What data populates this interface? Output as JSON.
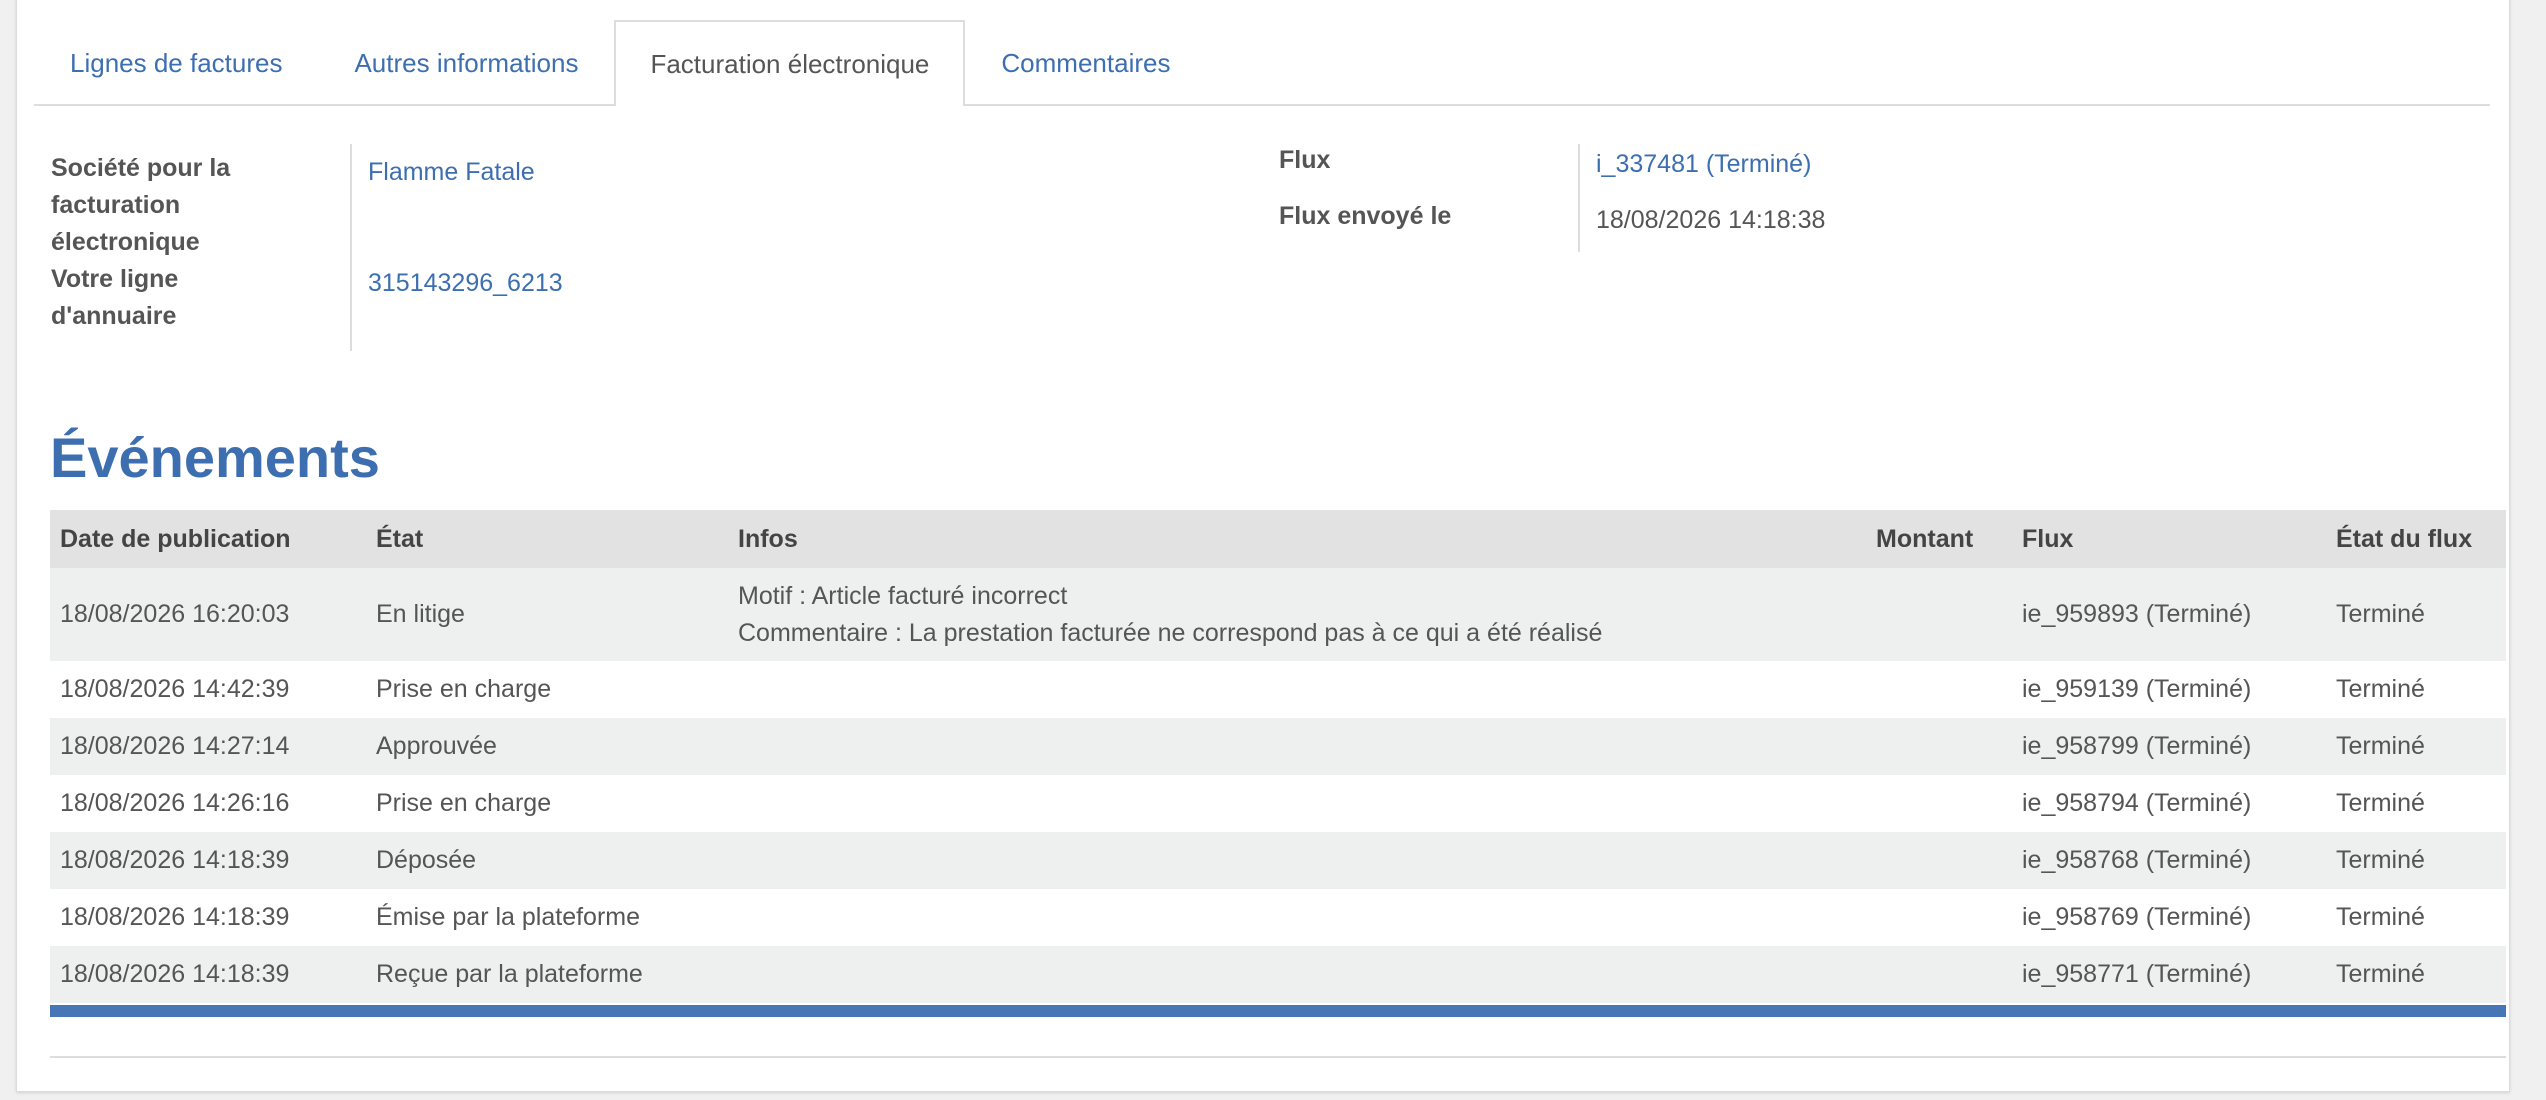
{
  "tabs": [
    {
      "label": "Lignes de factures",
      "active": false
    },
    {
      "label": "Autres informations",
      "active": false
    },
    {
      "label": "Facturation électronique",
      "active": true
    },
    {
      "label": "Commentaires",
      "active": false
    }
  ],
  "left_fields": {
    "company_label": "Société pour la facturation électronique",
    "company_value": "Flamme Fatale",
    "directory_label": "Votre ligne d'annuaire",
    "directory_value": "315143296_6213"
  },
  "right_fields": {
    "flux_label": "Flux",
    "flux_value": "i_337481 (Terminé)",
    "sent_label": "Flux envoyé le",
    "sent_value": "18/08/2026 14:18:38"
  },
  "events": {
    "title": "Événements",
    "columns": [
      "Date de publication",
      "État",
      "Infos",
      "Montant",
      "Flux",
      "État du flux"
    ],
    "rows": [
      {
        "date": "18/08/2026 16:20:03",
        "etat": "En litige",
        "infos_1": "Motif : Article facturé incorrect",
        "infos_2": "Commentaire : La prestation facturée ne correspond pas à ce qui a été réalisé",
        "montant": "",
        "flux": "ie_959893 (Terminé)",
        "etat_flux": "Terminé"
      },
      {
        "date": "18/08/2026 14:42:39",
        "etat": "Prise en charge",
        "infos_1": "",
        "infos_2": "",
        "montant": "",
        "flux": "ie_959139 (Terminé)",
        "etat_flux": "Terminé"
      },
      {
        "date": "18/08/2026 14:27:14",
        "etat": "Approuvée",
        "infos_1": "",
        "infos_2": "",
        "montant": "",
        "flux": "ie_958799 (Terminé)",
        "etat_flux": "Terminé"
      },
      {
        "date": "18/08/2026 14:26:16",
        "etat": "Prise en charge",
        "infos_1": "",
        "infos_2": "",
        "montant": "",
        "flux": "ie_958794 (Terminé)",
        "etat_flux": "Terminé"
      },
      {
        "date": "18/08/2026 14:18:39",
        "etat": "Déposée",
        "infos_1": "",
        "infos_2": "",
        "montant": "",
        "flux": "ie_958768 (Terminé)",
        "etat_flux": "Terminé"
      },
      {
        "date": "18/08/2026 14:18:39",
        "etat": "Émise par la plateforme",
        "infos_1": "",
        "infos_2": "",
        "montant": "",
        "flux": "ie_958769 (Terminé)",
        "etat_flux": "Terminé"
      },
      {
        "date": "18/08/2026 14:18:39",
        "etat": "Reçue par la plateforme",
        "infos_1": "",
        "infos_2": "",
        "montant": "",
        "flux": "ie_958771 (Terminé)",
        "etat_flux": "Terminé"
      }
    ]
  },
  "colors": {
    "link": "#3d6fb0",
    "accent_bar": "#4676b5",
    "header_bg": "#e2e2e2",
    "row_alt_bg": "#eef0ef"
  }
}
